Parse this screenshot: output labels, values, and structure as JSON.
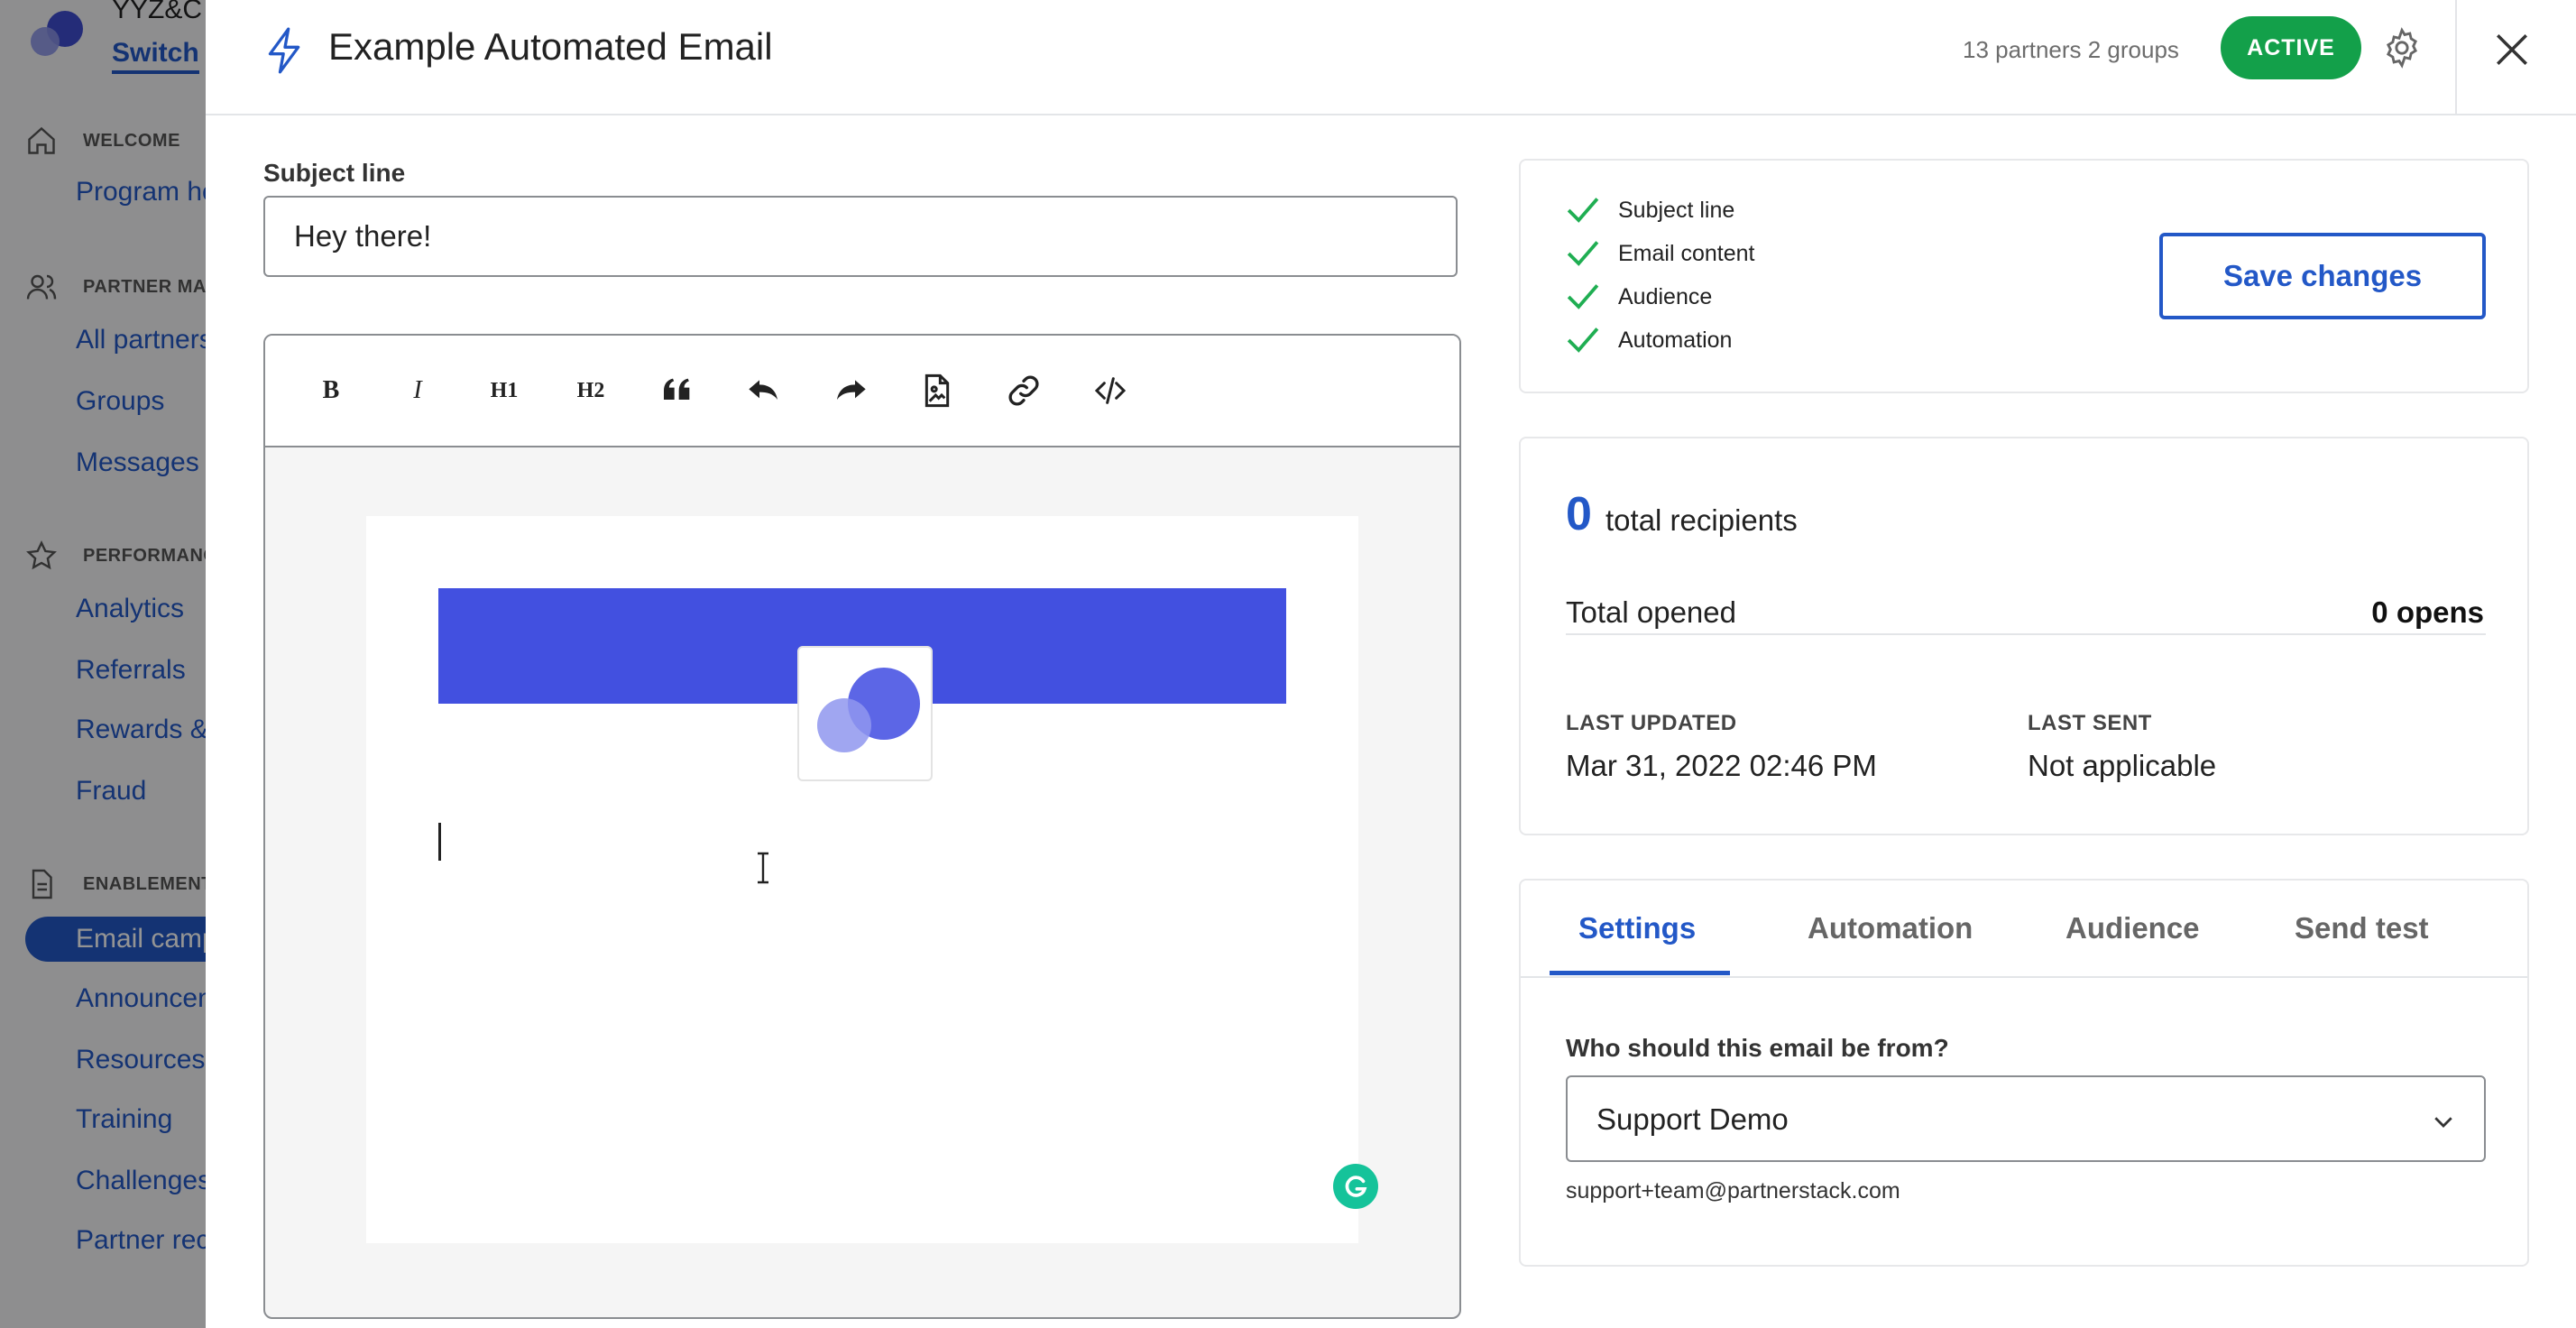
{
  "background_app": {
    "org_name": "YYZ&C",
    "org_switch_label": "Switch",
    "sections": {
      "welcome": "WELCOME",
      "partner_management": "PARTNER MAN",
      "performance": "PERFORMANC",
      "enablement": "ENABLEMENT"
    },
    "items": {
      "program_home": "Program ho",
      "all_partners": "All partners",
      "groups": "Groups",
      "messages": "Messages",
      "analytics": "Analytics",
      "referrals": "Referrals",
      "rewards": "Rewards &",
      "fraud": "Fraud",
      "email_campaigns": "Email camp",
      "announcements": "Announcen",
      "resources": "Resources",
      "training": "Training",
      "challenges": "Challenges",
      "partner_recruitment": "Partner rec"
    }
  },
  "header": {
    "title": "Example Automated Email",
    "counts": "13 partners 2 groups",
    "status": "ACTIVE",
    "icons": {
      "type": "bolt-icon",
      "settings": "gear-icon",
      "close": "close-icon"
    }
  },
  "editor": {
    "subject_label": "Subject line",
    "subject_value": "Hey there!",
    "toolbar": {
      "bold": "B",
      "italic": "I",
      "h1": "H1",
      "h2": "H2"
    },
    "colors": {
      "banner": "#4250e0",
      "accent": "#2358c7",
      "active": "#13a04a"
    }
  },
  "checklist": {
    "items": [
      "Subject line",
      "Email content",
      "Audience",
      "Automation"
    ],
    "save_label": "Save changes"
  },
  "stats": {
    "recipients_count": "0",
    "recipients_label": "total recipients",
    "opened_label": "Total opened",
    "opened_value": "0 opens",
    "last_updated_label": "LAST UPDATED",
    "last_updated_value": "Mar 31, 2022 02:46 PM",
    "last_sent_label": "LAST SENT",
    "last_sent_value": "Not applicable"
  },
  "settings": {
    "tabs": [
      "Settings",
      "Automation",
      "Audience",
      "Send test"
    ],
    "active_tab": "Settings",
    "from_label": "Who should this email be from?",
    "from_value": "Support Demo",
    "from_email": "support+team@partnerstack.com"
  }
}
